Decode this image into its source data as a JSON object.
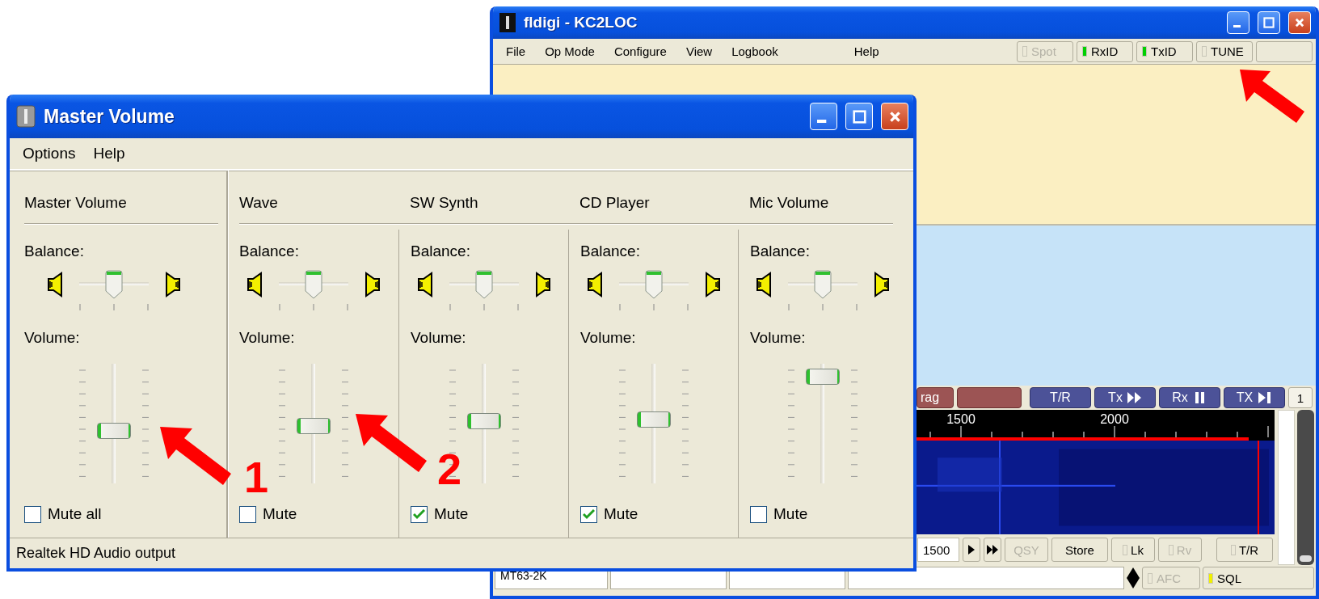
{
  "fldigi": {
    "title": "fldigi - KC2LOC",
    "menu": [
      "File",
      "Op Mode",
      "Configure",
      "View",
      "Logbook",
      "Help"
    ],
    "lights": [
      {
        "label": "Spot",
        "on": false,
        "disabled": true
      },
      {
        "label": "RxID",
        "on": true,
        "disabled": false,
        "color": "#00d000"
      },
      {
        "label": "TxID",
        "on": true,
        "disabled": false,
        "color": "#00d000"
      },
      {
        "label": "TUNE",
        "on": false,
        "disabled": false
      }
    ],
    "macro_button": "rag",
    "transport": [
      "T/R",
      "Tx",
      "Rx",
      "TX"
    ],
    "page_button": "1",
    "ruler": [
      "1500",
      "2000"
    ],
    "frequency": "1500",
    "controls": [
      {
        "label": "QSY",
        "kind": "button",
        "disabled": true
      },
      {
        "label": "Store",
        "kind": "button",
        "disabled": false
      },
      {
        "label": "Lk",
        "kind": "light",
        "disabled": false,
        "on": false
      },
      {
        "label": "Rv",
        "kind": "light",
        "disabled": true,
        "on": false
      },
      {
        "label": "T/R",
        "kind": "light",
        "disabled": false,
        "on": false
      }
    ],
    "mode": "MT63-2K",
    "status_lights": [
      {
        "label": "AFC",
        "on": false,
        "disabled": true
      },
      {
        "label": "SQL",
        "on": true,
        "disabled": false,
        "color": "#f0f000"
      }
    ]
  },
  "mixer": {
    "title": "Master Volume",
    "menu": [
      "Options",
      "Help"
    ],
    "channels": [
      {
        "name": "Master Volume",
        "balance_label": "Balance:",
        "balance": {
          "level": 0.5
        },
        "volume_label": "Volume:",
        "volume": {
          "level": 0.43
        },
        "mute_label": "Mute all",
        "muted": false
      },
      {
        "name": "Wave",
        "balance_label": "Balance:",
        "balance": {
          "level": 0.5
        },
        "volume_label": "Volume:",
        "volume": {
          "level": 0.48
        },
        "mute_label": "Mute",
        "muted": false
      },
      {
        "name": "SW Synth",
        "balance_label": "Balance:",
        "balance": {
          "level": 0.5
        },
        "volume_label": "Volume:",
        "volume": {
          "level": 0.52
        },
        "mute_label": "Mute",
        "muted": true
      },
      {
        "name": "CD Player",
        "balance_label": "Balance:",
        "balance": {
          "level": 0.5
        },
        "volume_label": "Volume:",
        "volume": {
          "level": 0.54
        },
        "mute_label": "Mute",
        "muted": true
      },
      {
        "name": "Mic Volume",
        "balance_label": "Balance:",
        "balance": {
          "level": 0.5
        },
        "volume_label": "Volume:",
        "volume": {
          "level": 0.95
        },
        "mute_label": "Mute",
        "muted": false
      }
    ],
    "status": "Realtek HD Audio output"
  },
  "callouts": [
    "1",
    "2"
  ]
}
